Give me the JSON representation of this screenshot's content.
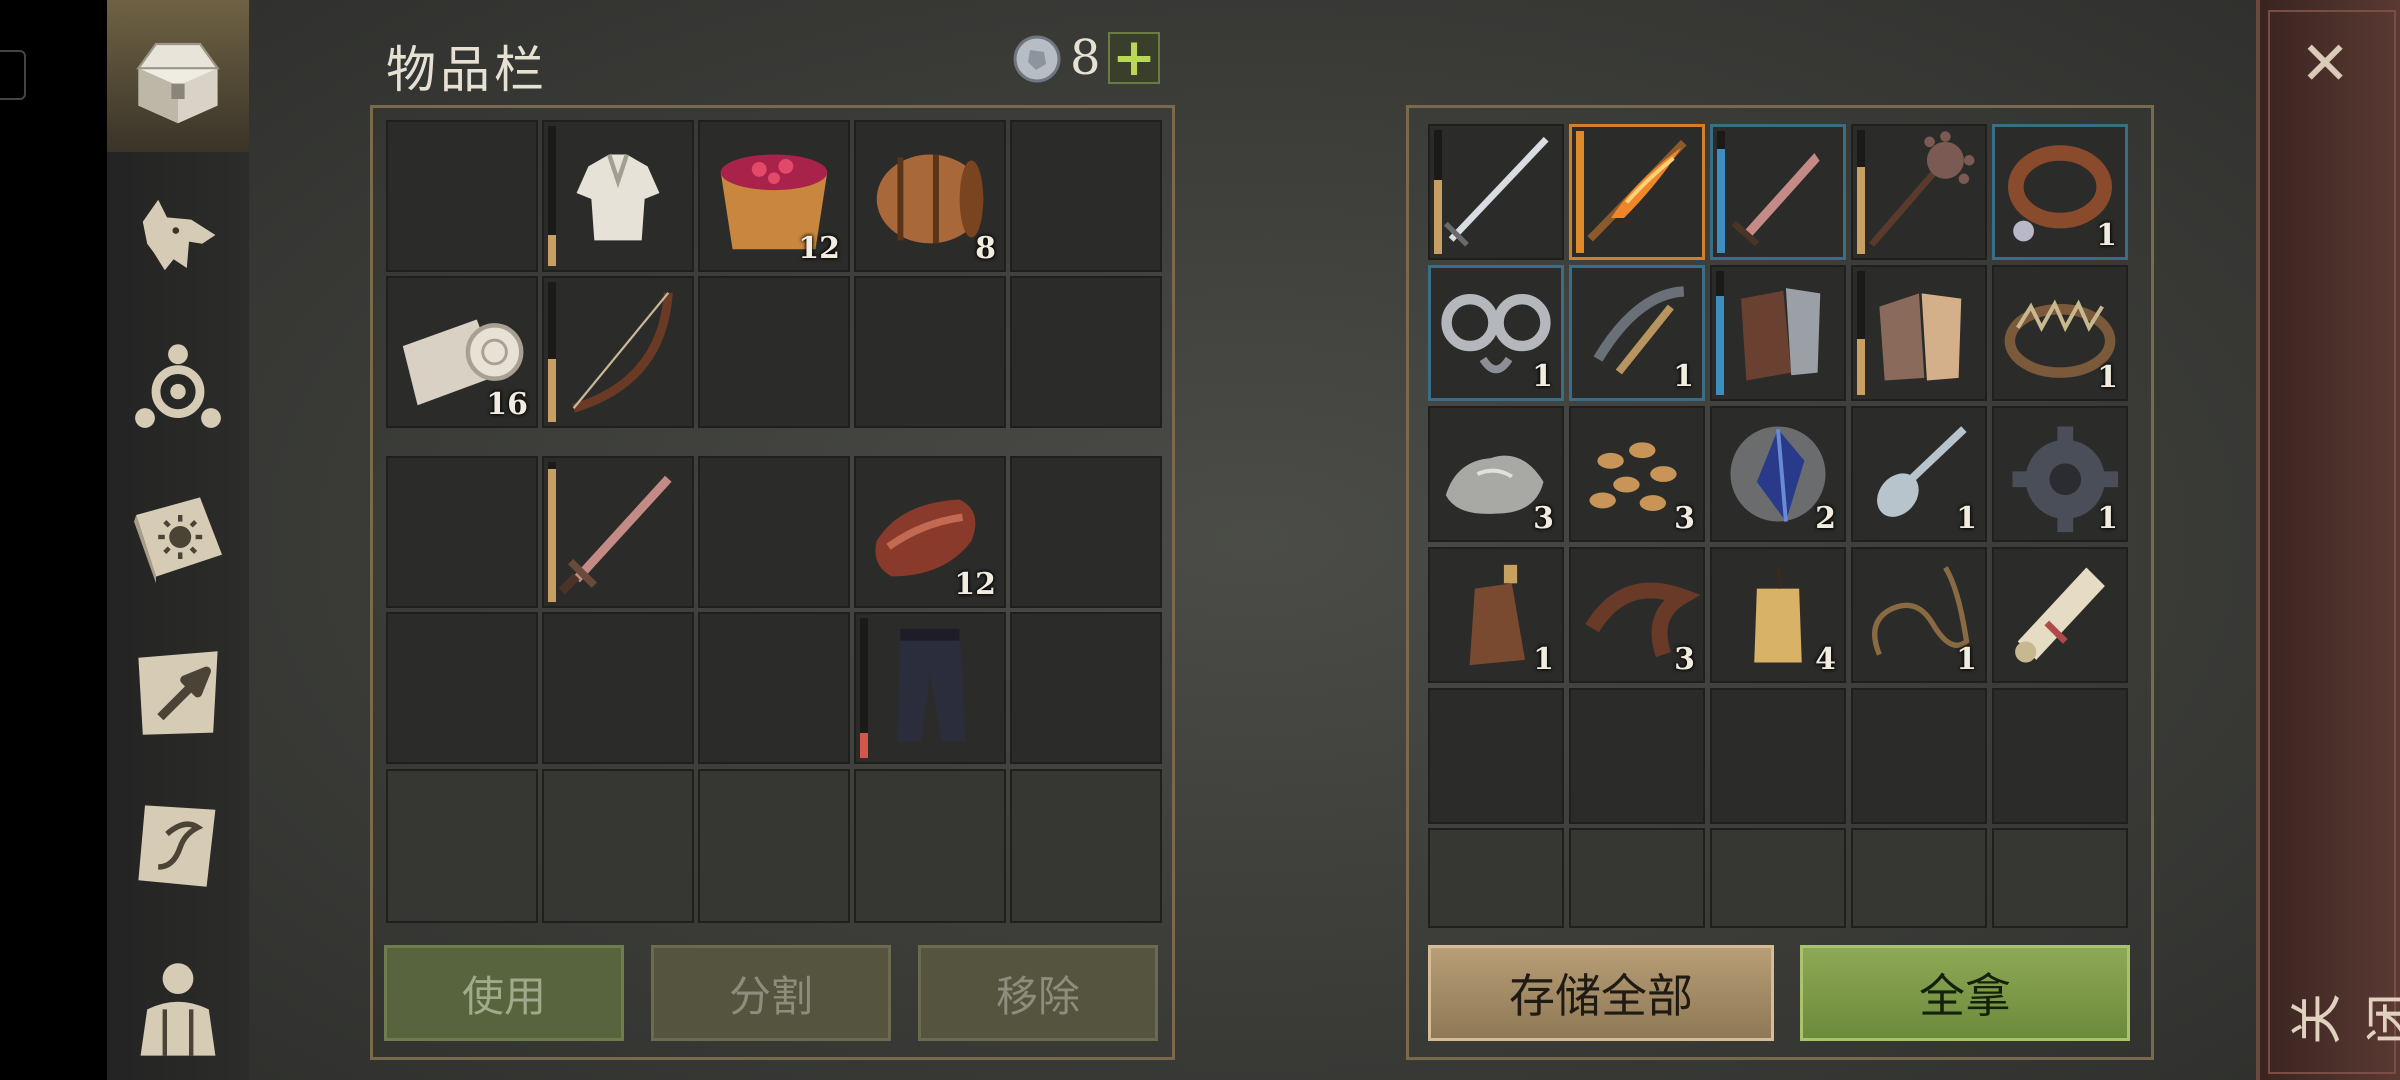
{
  "header": {
    "title": "物品栏",
    "currency_value": "8",
    "add_label": "+"
  },
  "inventory": {
    "slots": [
      {
        "icon": null
      },
      {
        "icon": "shirt-icon",
        "durability": 0.22,
        "dur_color": "#c9a064"
      },
      {
        "icon": "berry-bucket-icon",
        "count": "12"
      },
      {
        "icon": "barrel-icon",
        "count": "8"
      },
      {
        "icon": null
      },
      {
        "icon": "cloth-roll-icon",
        "count": "16"
      },
      {
        "icon": "bow-icon",
        "durability": 0.45,
        "dur_color": "#c9a064"
      },
      {
        "icon": null
      },
      {
        "icon": null
      },
      {
        "icon": null
      }
    ]
  },
  "equipment": {
    "slots": [
      {
        "icon": null
      },
      {
        "icon": "sword-icon",
        "durability": 0.95,
        "dur_color": "#c9a064"
      },
      {
        "icon": null
      },
      {
        "icon": "meat-icon",
        "count": "12"
      },
      {
        "icon": null
      },
      {
        "icon": null
      },
      {
        "icon": null
      },
      {
        "icon": null
      },
      {
        "icon": "pants-icon",
        "durability": 0.18,
        "dur_color": "#d0574a"
      },
      {
        "icon": null
      }
    ]
  },
  "actions": {
    "use": "使用",
    "split": "分割",
    "remove": "移除"
  },
  "storage": {
    "slots": [
      {
        "icon": "longsword-icon",
        "durability": 0.6,
        "dur_color": "#c9a064"
      },
      {
        "icon": "flame-blade-icon",
        "durability": 1.0,
        "dur_color": "#e08a2a",
        "hl": "orange"
      },
      {
        "icon": "dagger-icon",
        "durability": 0.85,
        "dur_color": "#3c8fc0",
        "hl": "blue"
      },
      {
        "icon": "mace-icon",
        "durability": 0.7,
        "dur_color": "#c9a064"
      },
      {
        "icon": "collar-icon",
        "count": "1",
        "hl": "blue"
      },
      {
        "icon": "shackles-icon",
        "count": "1",
        "hl": "blue"
      },
      {
        "icon": "crossbow-icon",
        "count": "1",
        "hl": "blue"
      },
      {
        "icon": "gauntlet-icon",
        "durability": 0.8,
        "dur_color": "#3c8fc0"
      },
      {
        "icon": "chain-glove-icon",
        "durability": 0.45,
        "dur_color": "#c9a064"
      },
      {
        "icon": "bear-trap-icon",
        "count": "1"
      },
      {
        "icon": "stone-icon",
        "count": "3"
      },
      {
        "icon": "seeds-icon",
        "count": "3"
      },
      {
        "icon": "crystal-icon",
        "count": "2"
      },
      {
        "icon": "spoon-icon",
        "count": "1"
      },
      {
        "icon": "gear-part-icon",
        "count": "1"
      },
      {
        "icon": "flask-icon",
        "count": "1"
      },
      {
        "icon": "leather-strap-icon",
        "count": "3"
      },
      {
        "icon": "candle-icon",
        "count": "4"
      },
      {
        "icon": "rope-icon",
        "count": "1"
      },
      {
        "icon": "scroll-icon"
      },
      {
        "icon": null
      },
      {
        "icon": null
      },
      {
        "icon": null
      },
      {
        "icon": null
      },
      {
        "icon": null
      }
    ]
  },
  "storage_actions": {
    "store_all": "存储全部",
    "take_all": "全拿"
  },
  "close": {
    "label": "关闭",
    "x": "✕"
  },
  "colors": {
    "accent_green": "#7f9a4a",
    "gold": "#c9a064",
    "panel_border": "#7a6a4c"
  }
}
